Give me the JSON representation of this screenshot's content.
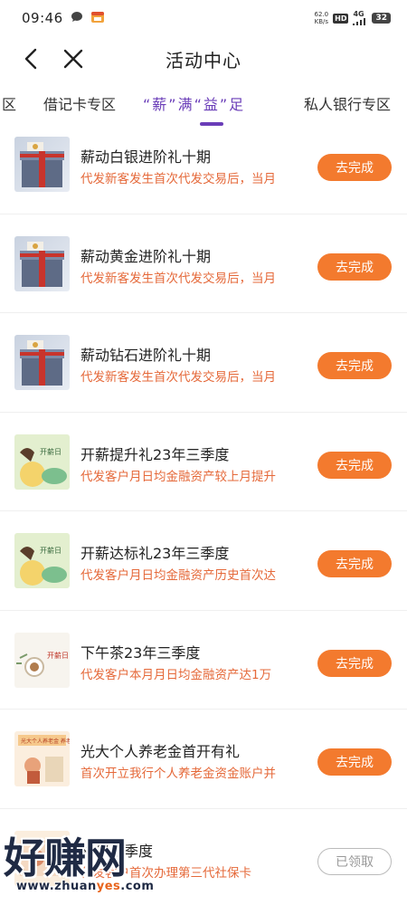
{
  "status_bar": {
    "time": "09:46",
    "speed": "62.0",
    "speed_unit": "KB/s",
    "hd": "HD",
    "network": "4G",
    "battery": "32"
  },
  "header": {
    "title": "活动中心"
  },
  "tabs": [
    {
      "label": "区"
    },
    {
      "label": "借记卡专区"
    },
    {
      "label": "“薪”满“益”足"
    },
    {
      "label": "私人银行专区"
    }
  ],
  "items": [
    {
      "title": "薪动白银进阶礼十期",
      "desc": "代发新客发生首次代发交易后，当月",
      "button": "去完成"
    },
    {
      "title": "薪动黄金进阶礼十期",
      "desc": "代发新客发生首次代发交易后，当月",
      "button": "去完成"
    },
    {
      "title": "薪动钻石进阶礼十期",
      "desc": "代发新客发生首次代发交易后，当月",
      "button": "去完成"
    },
    {
      "title": "开薪提升礼23年三季度",
      "desc": "代发客户月日均金融资产较上月提升",
      "button": "去完成",
      "thumb_text": "开薪日"
    },
    {
      "title": "开薪达标礼23年三季度",
      "desc": "代发客户月日均金融资产历史首次达",
      "button": "去完成",
      "thumb_text": "开薪日"
    },
    {
      "title": "下午茶23年三季度",
      "desc": "代发客户本月月日均金融资产达1万",
      "button": "去完成",
      "thumb_text": "开薪日 下午茶"
    },
    {
      "title": "光大个人养老金首开有礼",
      "desc": "首次开立我行个人养老金资金账户并",
      "button": "去完成",
      "thumb_text": "光大个人养老金 养老有礼"
    },
    {
      "title": "相伴三季度",
      "desc": "代发客户首次办理第三代社保卡",
      "button": "已领取"
    }
  ],
  "watermark": {
    "text": "好赚网",
    "url_prefix": "www.zhuan",
    "url_highlight": "yes",
    "url_suffix": ".com"
  },
  "colors": {
    "accent_purple": "#6a3db8",
    "button_orange": "#f37a2e",
    "desc_orange": "#e5693a"
  }
}
